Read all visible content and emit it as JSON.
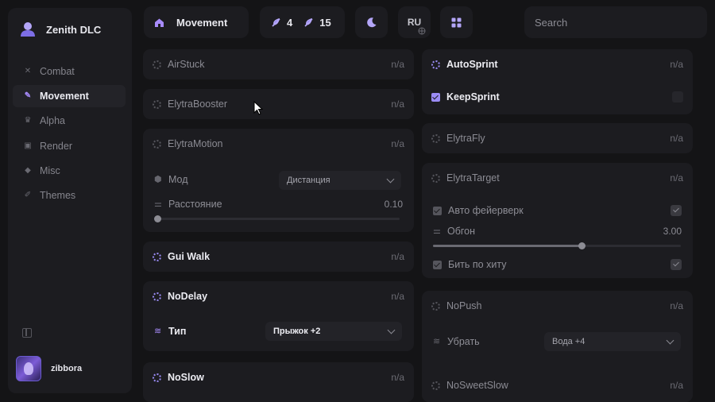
{
  "brand": {
    "name": "Zenith DLC"
  },
  "sidebar": {
    "items": [
      {
        "label": "Combat",
        "icon": "sword-icon"
      },
      {
        "label": "Movement",
        "icon": "feather-icon",
        "active": true
      },
      {
        "label": "Alpha",
        "icon": "crown-icon"
      },
      {
        "label": "Render",
        "icon": "image-icon"
      },
      {
        "label": "Misc",
        "icon": "diamond-icon"
      },
      {
        "label": "Themes",
        "icon": "brush-icon"
      }
    ]
  },
  "user": {
    "name": "zibbora"
  },
  "topbar": {
    "breadcrumb": "Movement",
    "count_a": "4",
    "count_b": "15",
    "language": "RU",
    "search_placeholder": "Search"
  },
  "left_column": {
    "airstuck": {
      "name": "AirStuck",
      "bind": "n/a"
    },
    "elytrabooster": {
      "name": "ElytraBooster",
      "bind": "n/a"
    },
    "elytramotion": {
      "name": "ElytraMotion",
      "bind": "n/a",
      "mode_label": "Мод",
      "mode_value": "Дистанция",
      "distance_label": "Расстояние",
      "distance_value": "0.10"
    },
    "guiwalk": {
      "name": "Gui Walk",
      "bind": "n/a"
    },
    "nodelay": {
      "name": "NoDelay",
      "bind": "n/a",
      "type_label": "Тип",
      "type_value": "Прыжок +2"
    },
    "noslow": {
      "name": "NoSlow",
      "bind": "n/a"
    }
  },
  "right_column": {
    "autosprint": {
      "name": "AutoSprint",
      "bind": "n/a"
    },
    "keepsprint": {
      "name": "KeepSprint"
    },
    "elytrafly": {
      "name": "ElytraFly",
      "bind": "n/a"
    },
    "elytratarget": {
      "name": "ElytraTarget",
      "bind": "n/a",
      "auto_firework_label": "Авто фейерверк",
      "overtake_label": "Обгон",
      "overtake_value": "3.00",
      "hit_label": "Бить по хиту"
    },
    "nopush": {
      "name": "NoPush",
      "bind": "n/a",
      "remove_label": "Убрать",
      "remove_value": "Вода +4"
    },
    "nosweetslow": {
      "name": "NoSweetSlow",
      "bind": "n/a"
    }
  },
  "sliders": {
    "distance_fraction": 0.0,
    "overtake_fraction": 0.6
  },
  "colors": {
    "accent": "#9b8cf5",
    "background": "#141416",
    "panel": "#1c1c20"
  }
}
